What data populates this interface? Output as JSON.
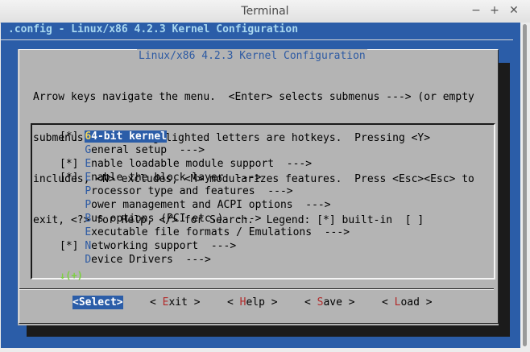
{
  "window": {
    "title": "Terminal",
    "minimize_glyph": "−",
    "maximize_glyph": "+",
    "close_glyph": "✕"
  },
  "config_bar": ".config - Linux/x86 4.2.3 Kernel Configuration",
  "dialog": {
    "title": "Linux/x86 4.2.3 Kernel Configuration",
    "help_lines": [
      "Arrow keys navigate the menu.  <Enter> selects submenus ---> (or empty",
      "submenus ----).  Highlighted letters are hotkeys.  Pressing <Y>",
      "includes, <N> excludes, <M> modularizes features.  Press <Esc><Esc> to",
      "exit, <?> for Help, </> for Search.  Legend: [*] built-in  [ ]"
    ],
    "menu_items": [
      {
        "prefix": "[*] ",
        "hotkey": "6",
        "rest": "4-bit kernel",
        "suffix": "",
        "selected": true
      },
      {
        "prefix": "    ",
        "hotkey": "G",
        "rest": "eneral setup",
        "suffix": "  --->",
        "selected": false
      },
      {
        "prefix": "[*] ",
        "hotkey": "E",
        "rest": "nable loadable module support",
        "suffix": "  --->",
        "selected": false
      },
      {
        "prefix": "[*] ",
        "hotkey": "E",
        "rest": "nable the block layer",
        "suffix": "  --->",
        "selected": false
      },
      {
        "prefix": "    ",
        "hotkey": "P",
        "rest": "rocessor type and features",
        "suffix": "  --->",
        "selected": false
      },
      {
        "prefix": "    ",
        "hotkey": "P",
        "rest": "ower management and ACPI options",
        "suffix": "  --->",
        "selected": false
      },
      {
        "prefix": "    ",
        "hotkey": "B",
        "rest": "us options (PCI etc.)",
        "suffix": "  --->",
        "selected": false
      },
      {
        "prefix": "    ",
        "hotkey": "E",
        "rest": "xecutable file formats / Emulations",
        "suffix": "  --->",
        "selected": false
      },
      {
        "prefix": "[*] ",
        "hotkey": "N",
        "rest": "etworking support",
        "suffix": "  --->",
        "selected": false
      },
      {
        "prefix": "    ",
        "hotkey": "D",
        "rest": "evice Drivers",
        "suffix": "  --->",
        "selected": false
      }
    ],
    "more_indicator": "↓(+)",
    "buttons": [
      {
        "open": "<",
        "hotkey": "S",
        "rest": "elect",
        "close": ">",
        "selected": true
      },
      {
        "open": "< ",
        "hotkey": "E",
        "rest": "xit",
        "close": " >",
        "selected": false
      },
      {
        "open": "< ",
        "hotkey": "H",
        "rest": "elp",
        "close": " >",
        "selected": false
      },
      {
        "open": "< ",
        "hotkey": "S",
        "rest": "ave",
        "close": " >",
        "selected": false
      },
      {
        "open": "< ",
        "hotkey": "L",
        "rest": "oad",
        "close": " >",
        "selected": false
      }
    ]
  },
  "colors": {
    "terminal_bg": "#2b5da8",
    "dialog_bg": "#b4b4b4",
    "hotkey": "#2d5aa3",
    "button_hotkey": "#b22a2a",
    "more_indicator": "#7bd23f"
  }
}
